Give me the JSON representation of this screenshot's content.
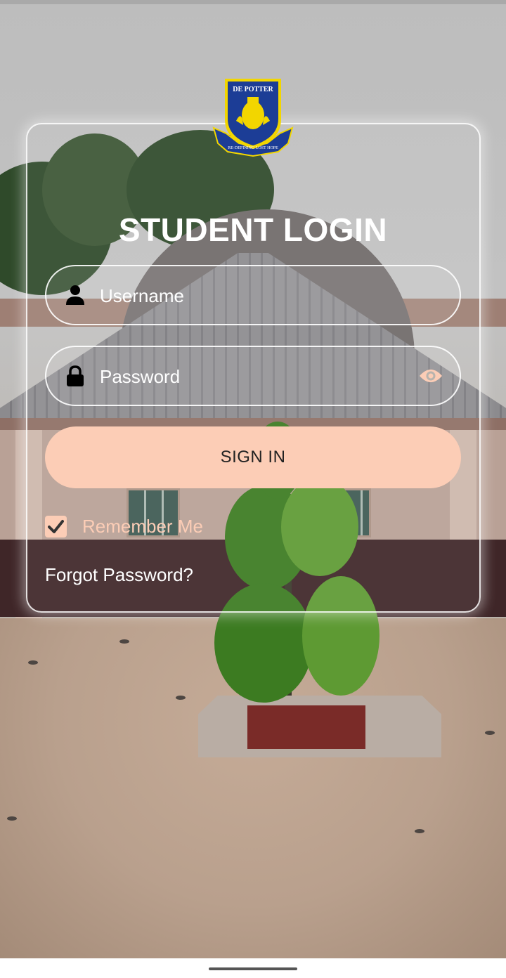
{
  "logo": {
    "name": "school-crest",
    "top_text": "DE POTTER",
    "motto": "RE-DEFINING LOST HOPE",
    "colors": {
      "shield": "#1c3d96",
      "gold": "#f2d600",
      "ribbon": "#1c3d96"
    }
  },
  "login": {
    "title": "STUDENT LOGIN",
    "username_placeholder": "Username",
    "password_placeholder": "Password",
    "sign_in_label": "SIGN IN",
    "remember_me_label": "Remember Me",
    "remember_me_checked": true,
    "forgot_password_label": "Forgot Password?"
  },
  "icons": {
    "username": "person-icon",
    "password": "lock-icon",
    "toggle_password": "eye-icon",
    "checkbox": "checkmark-icon"
  },
  "theme": {
    "accent": "#fccdb6",
    "text_on_accent": "#222222",
    "text": "#ffffff"
  }
}
